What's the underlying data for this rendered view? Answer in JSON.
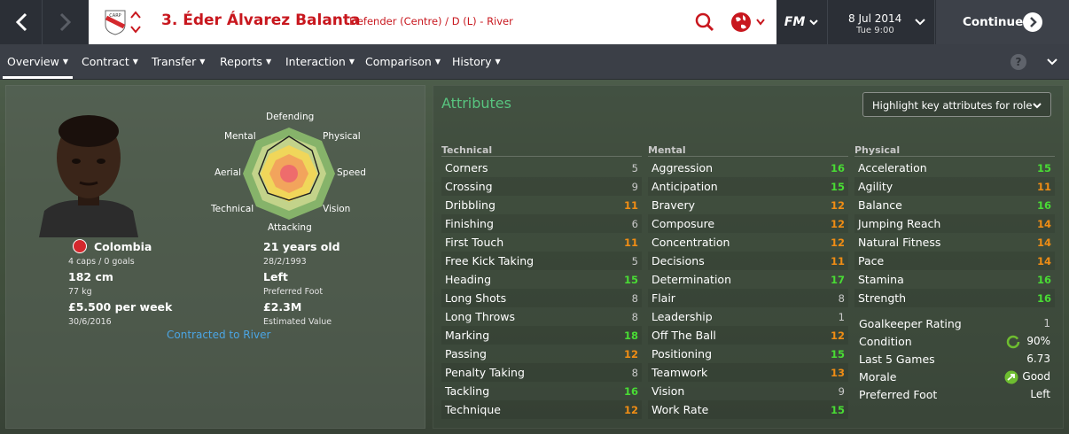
{
  "header": {
    "player_name": "3. Éder Álvarez Balanta",
    "player_role": "Defender (Centre) / D (L) - River",
    "fm_label": "FM",
    "date": "8 Jul 2014",
    "day_time": "Tue 9:00",
    "continue_label": "Continue",
    "accent_color": "#c8171e"
  },
  "tabs": [
    {
      "label": "Overview"
    },
    {
      "label": "Contract"
    },
    {
      "label": "Transfer"
    },
    {
      "label": "Reports"
    },
    {
      "label": "Interaction"
    },
    {
      "label": "Comparison"
    },
    {
      "label": "History"
    }
  ],
  "help_label": "?",
  "profile": {
    "radar_labels": {
      "defending": "Defending",
      "physical": "Physical",
      "speed": "Speed",
      "vision": "Vision",
      "attacking": "Attacking",
      "technical": "Technical",
      "aerial": "Aerial",
      "mental": "Mental"
    },
    "nation": "Colombia",
    "caps_goals": "4 caps / 0 goals",
    "height": "182 cm",
    "weight": "77 kg",
    "wage": "£5.500 per week",
    "contract_end": "30/6/2016",
    "age": "21 years old",
    "dob": "28/2/1993",
    "foot": "Left",
    "foot_label": "Preferred Foot",
    "value": "£2.3M",
    "value_label": "Estimated Value",
    "contracted": "Contracted to River"
  },
  "attributes": {
    "title": "Attributes",
    "highlight_label": "Highlight key attributes for role",
    "technical_head": "Technical",
    "mental_head": "Mental",
    "physical_head": "Physical",
    "technical": [
      {
        "name": "Corners",
        "value": "5"
      },
      {
        "name": "Crossing",
        "value": "9"
      },
      {
        "name": "Dribbling",
        "value": "11"
      },
      {
        "name": "Finishing",
        "value": "6"
      },
      {
        "name": "First Touch",
        "value": "11"
      },
      {
        "name": "Free Kick Taking",
        "value": "5"
      },
      {
        "name": "Heading",
        "value": "15"
      },
      {
        "name": "Long Shots",
        "value": "8"
      },
      {
        "name": "Long Throws",
        "value": "8"
      },
      {
        "name": "Marking",
        "value": "18"
      },
      {
        "name": "Passing",
        "value": "12"
      },
      {
        "name": "Penalty Taking",
        "value": "8"
      },
      {
        "name": "Tackling",
        "value": "16"
      },
      {
        "name": "Technique",
        "value": "12"
      }
    ],
    "mental": [
      {
        "name": "Aggression",
        "value": "16"
      },
      {
        "name": "Anticipation",
        "value": "15"
      },
      {
        "name": "Bravery",
        "value": "12"
      },
      {
        "name": "Composure",
        "value": "12"
      },
      {
        "name": "Concentration",
        "value": "12"
      },
      {
        "name": "Decisions",
        "value": "11"
      },
      {
        "name": "Determination",
        "value": "17"
      },
      {
        "name": "Flair",
        "value": "8"
      },
      {
        "name": "Leadership",
        "value": "1"
      },
      {
        "name": "Off The Ball",
        "value": "12"
      },
      {
        "name": "Positioning",
        "value": "15"
      },
      {
        "name": "Teamwork",
        "value": "13"
      },
      {
        "name": "Vision",
        "value": "9"
      },
      {
        "name": "Work Rate",
        "value": "15"
      }
    ],
    "physical": [
      {
        "name": "Acceleration",
        "value": "15"
      },
      {
        "name": "Agility",
        "value": "11"
      },
      {
        "name": "Balance",
        "value": "16"
      },
      {
        "name": "Jumping Reach",
        "value": "14"
      },
      {
        "name": "Natural Fitness",
        "value": "14"
      },
      {
        "name": "Pace",
        "value": "14"
      },
      {
        "name": "Stamina",
        "value": "16"
      },
      {
        "name": "Strength",
        "value": "16"
      }
    ],
    "extra": [
      {
        "name": "Goalkeeper Rating",
        "value": "1"
      },
      {
        "name": "Condition",
        "value": "90%",
        "icon": "condition-ring-icon"
      },
      {
        "name": "Last 5 Games",
        "value": "6.73"
      },
      {
        "name": "Morale",
        "value": "Good",
        "icon": "morale-arrow-icon"
      },
      {
        "name": "Preferred Foot",
        "value": "Left"
      }
    ]
  }
}
